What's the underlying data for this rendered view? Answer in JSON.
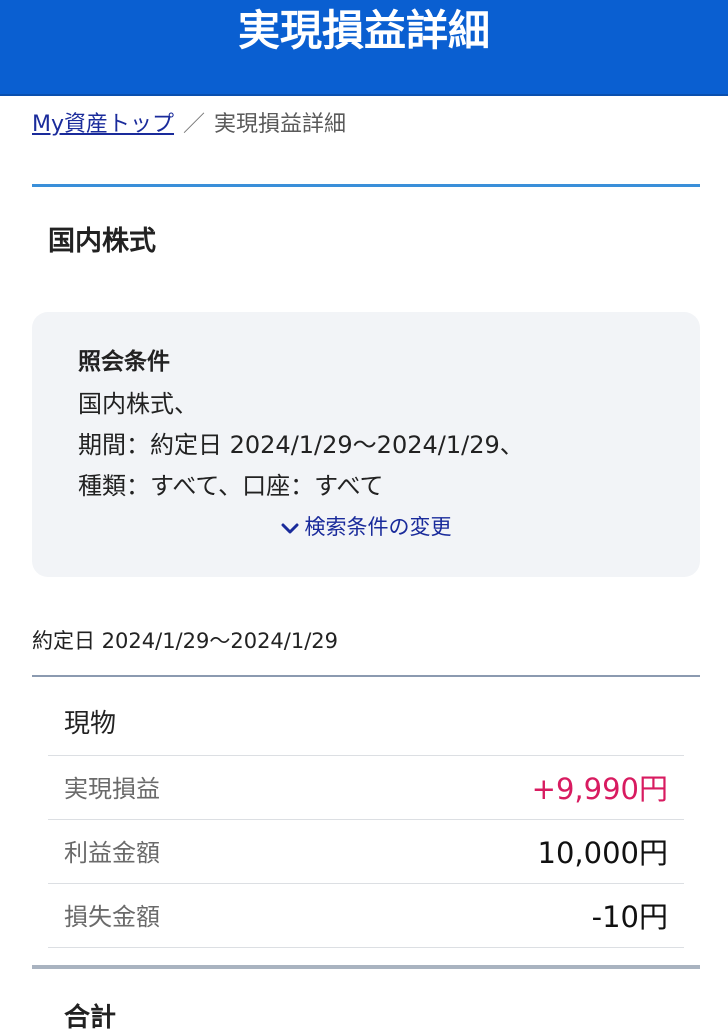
{
  "header": {
    "title": "実現損益詳細"
  },
  "breadcrumb": {
    "home_link": "My資産トップ",
    "separator": "／",
    "current": "実現損益詳細"
  },
  "section": {
    "title": "国内株式"
  },
  "conditions": {
    "title": "照会条件",
    "lines": [
      "国内株式、",
      "期間：約定日 2024/1/29〜2024/1/29、",
      "種類：すべて、口座：すべて"
    ],
    "change_link": "検索条件の変更",
    "change_icon": "chevron-down-icon"
  },
  "results": {
    "date_range": "約定日 2024/1/29〜2024/1/29",
    "group_title": "現物",
    "rows": [
      {
        "label": "実現損益",
        "value": "+9,990円"
      },
      {
        "label": "利益金額",
        "value": "10,000円"
      },
      {
        "label": "損失金額",
        "value": "-10円"
      }
    ],
    "total_title": "合計"
  },
  "colors": {
    "header_bg": "#0a5fd1",
    "link": "#1a2b9b",
    "profit": "#d81b60",
    "section_rule": "#3a8fd9",
    "panel_bg": "#f2f4f7"
  }
}
